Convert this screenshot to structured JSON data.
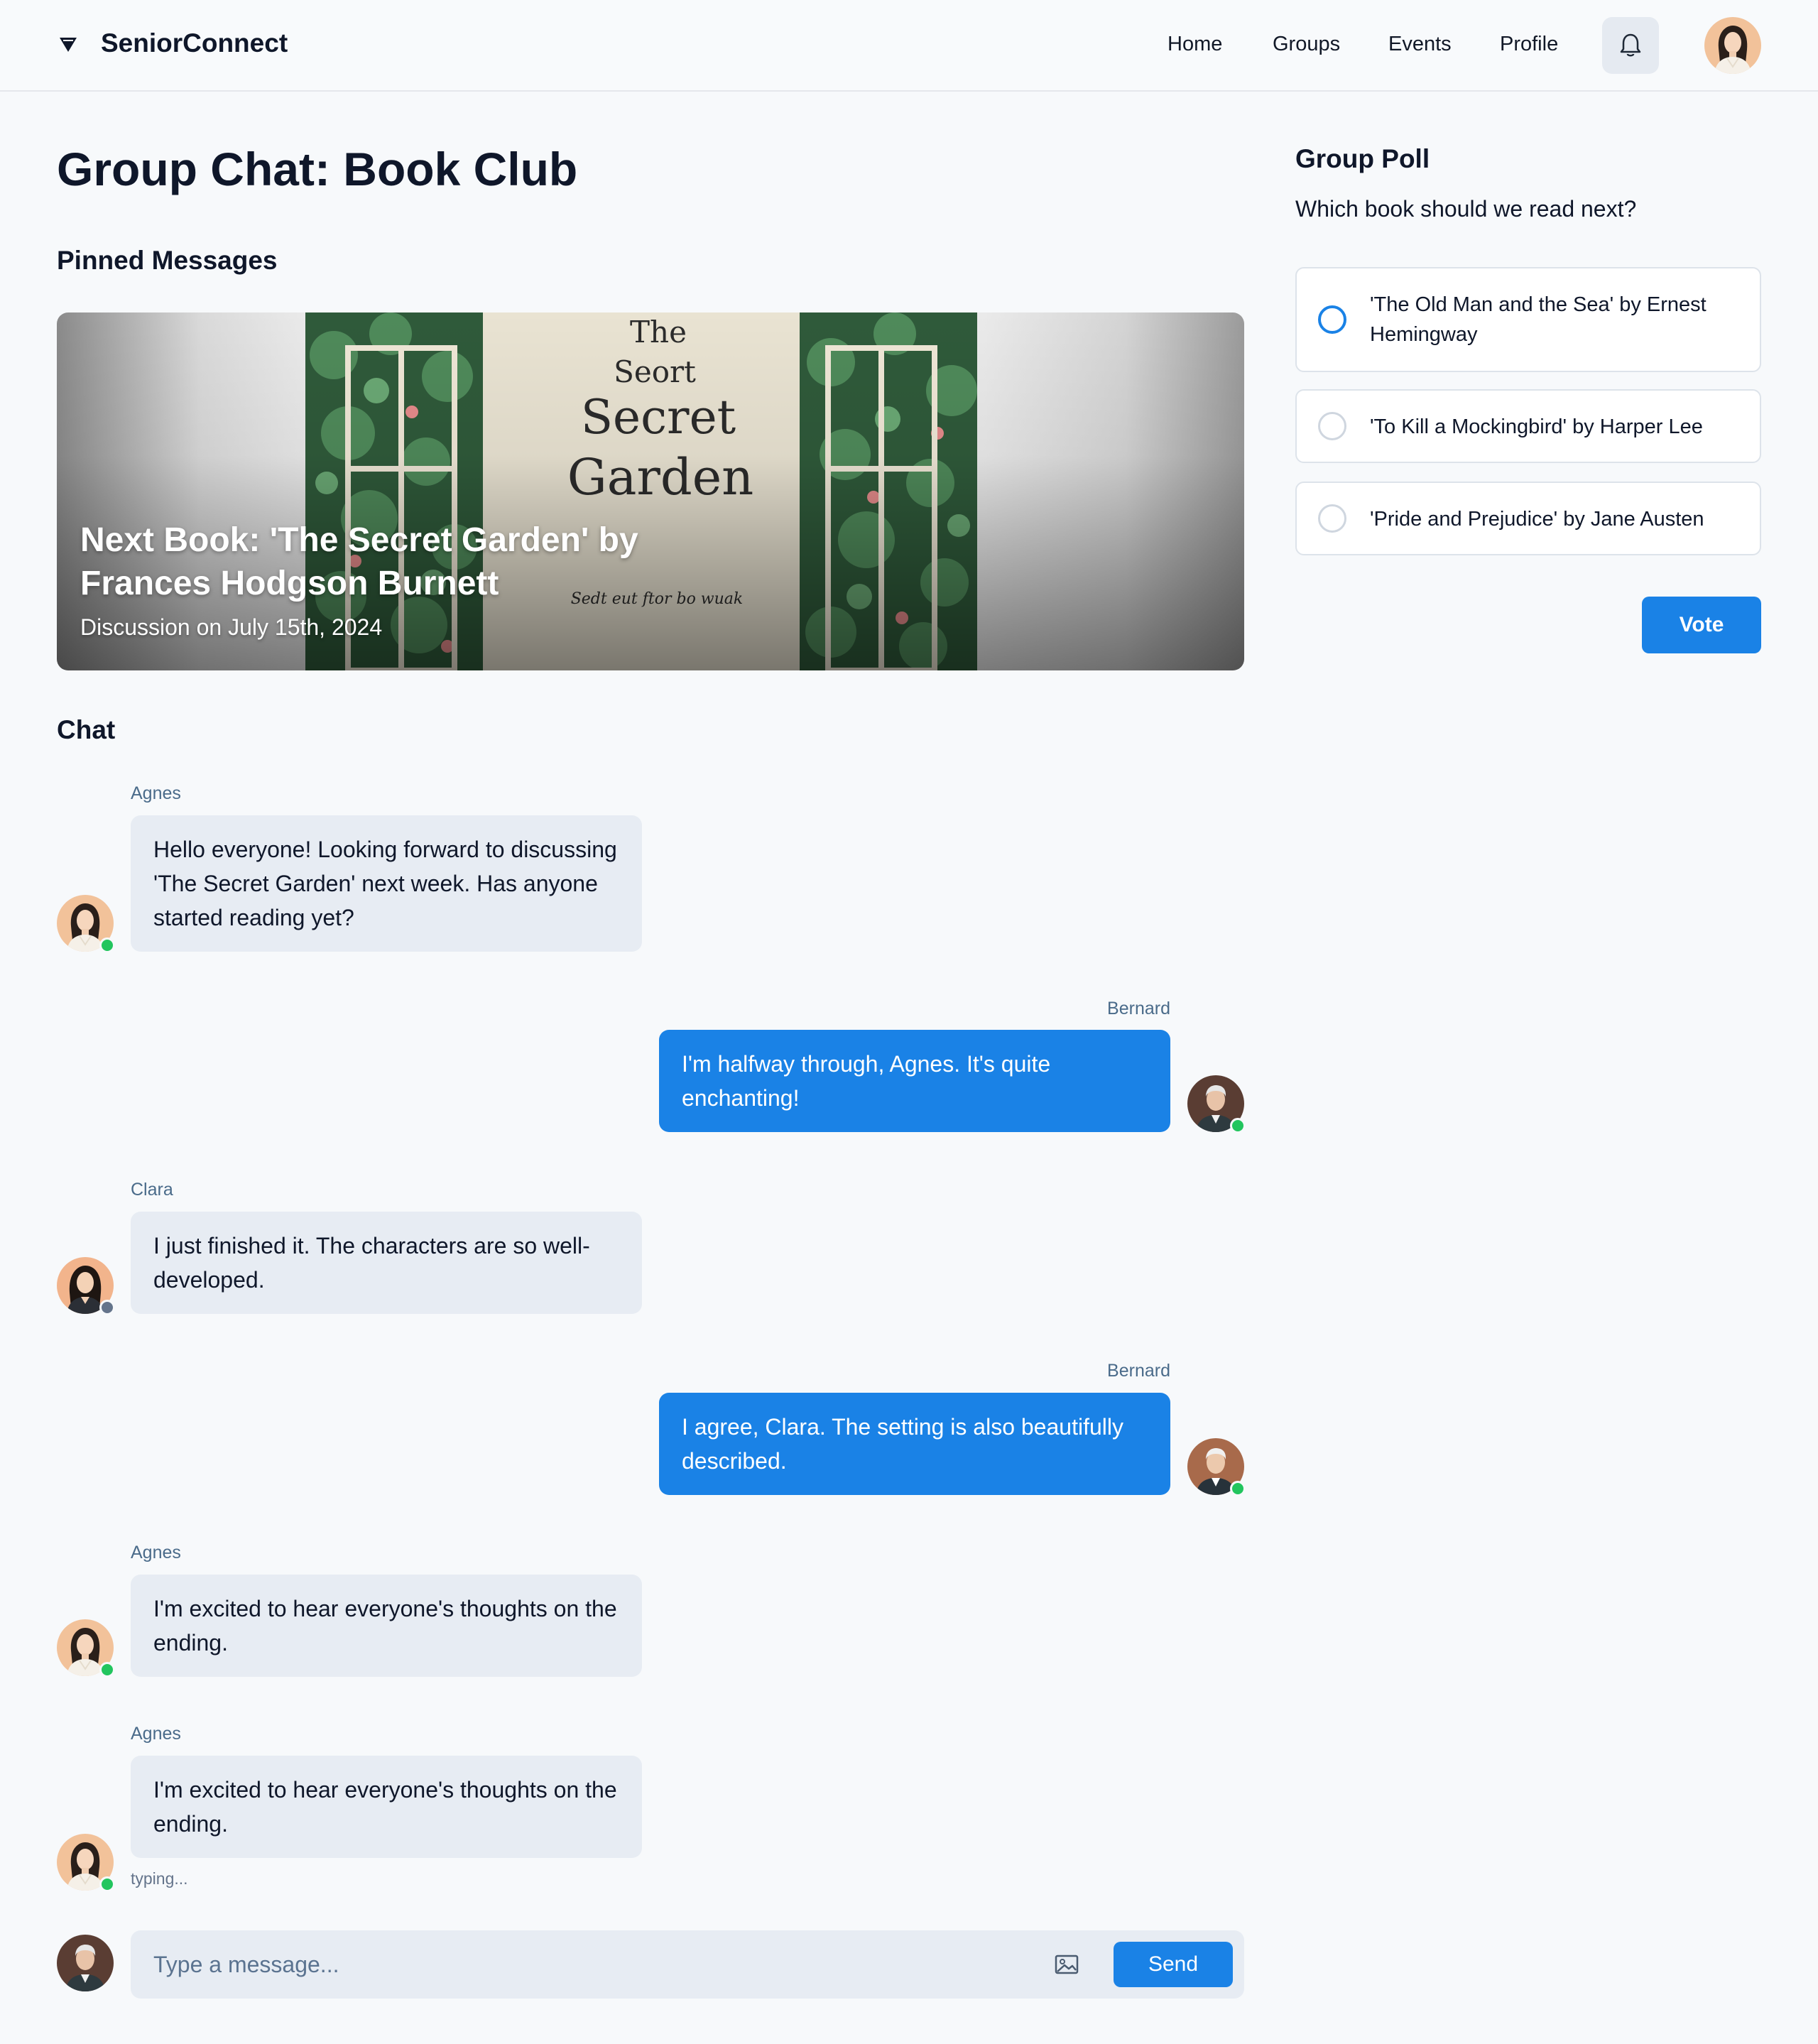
{
  "header": {
    "brand": "SeniorConnect",
    "nav": [
      "Home",
      "Groups",
      "Events",
      "Profile"
    ]
  },
  "page": {
    "title": "Group Chat: Book Club"
  },
  "pinned": {
    "heading": "Pinned Messages",
    "title": "Next Book: 'The Secret Garden' by Frances Hodgson Burnett",
    "subtitle": "Discussion on July 15th, 2024"
  },
  "chat": {
    "heading": "Chat",
    "messages": [
      {
        "author": "Agnes",
        "text": "Hello everyone! Looking forward to discussing 'The Secret Garden' next week. Has anyone started reading yet?",
        "status": "online"
      },
      {
        "author": "Bernard",
        "text": "I'm halfway through, Agnes. It's quite enchanting!",
        "status": "online"
      },
      {
        "author": "Clara",
        "text": "I just finished it. The characters are so well-developed.",
        "status": "offline"
      },
      {
        "author": "Bernard",
        "text": "I agree, Clara. The setting is also beautifully described.",
        "status": "online"
      },
      {
        "author": "Agnes",
        "text": "I'm excited to hear everyone's thoughts on the ending.",
        "status": "online"
      },
      {
        "author": "Agnes",
        "text": "I'm excited to hear everyone's thoughts on the ending.",
        "status": "online"
      }
    ],
    "typing": "typing..."
  },
  "composer": {
    "placeholder": "Type a message...",
    "send_label": "Send"
  },
  "poll": {
    "title": "Group Poll",
    "question": "Which book should we read next?",
    "options": [
      "'The Old Man and the Sea' by Ernest Hemingway",
      "'To Kill a Mockingbird' by Harper Lee",
      "'Pride and Prejudice' by Jane Austen"
    ],
    "vote_label": "Vote"
  },
  "colors": {
    "accent": "#1a82e6",
    "online": "#22c55e",
    "offline": "#64748b"
  },
  "icons": {
    "brand": "diamond-logo-icon",
    "notifications": "bell-icon",
    "attach": "image-icon"
  }
}
